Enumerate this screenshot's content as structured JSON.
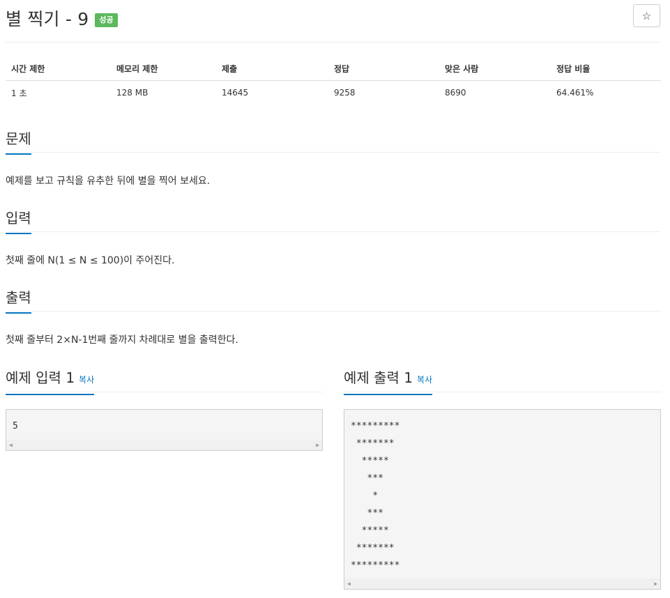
{
  "header": {
    "title": "별 찍기 - 9",
    "badge": "성공",
    "star_icon": "☆"
  },
  "stats": {
    "headers": [
      "시간 제한",
      "메모리 제한",
      "제출",
      "정답",
      "맞은 사람",
      "정답 비율"
    ],
    "values": [
      "1 초",
      "128 MB",
      "14645",
      "9258",
      "8690",
      "64.461%"
    ]
  },
  "problem": {
    "heading": "문제",
    "text": "예제를 보고 규칙을 유추한 뒤에 별을 찍어 보세요."
  },
  "input": {
    "heading": "입력",
    "text": "첫째 줄에 N(1 ≤ N ≤ 100)이 주어진다."
  },
  "output": {
    "heading": "출력",
    "text": "첫째 줄부터 2×N-1번째 줄까지 차례대로 별을 출력한다."
  },
  "sample_input": {
    "heading": "예제 입력 1",
    "copy_label": "복사",
    "content": "5"
  },
  "sample_output": {
    "heading": "예제 출력 1",
    "copy_label": "복사",
    "content": "*********\n *******\n  *****\n   ***\n    *\n   ***\n  *****\n *******\n*********"
  },
  "colors": {
    "badge_success": "#5cb85c",
    "accent_blue": "#0076c0"
  }
}
